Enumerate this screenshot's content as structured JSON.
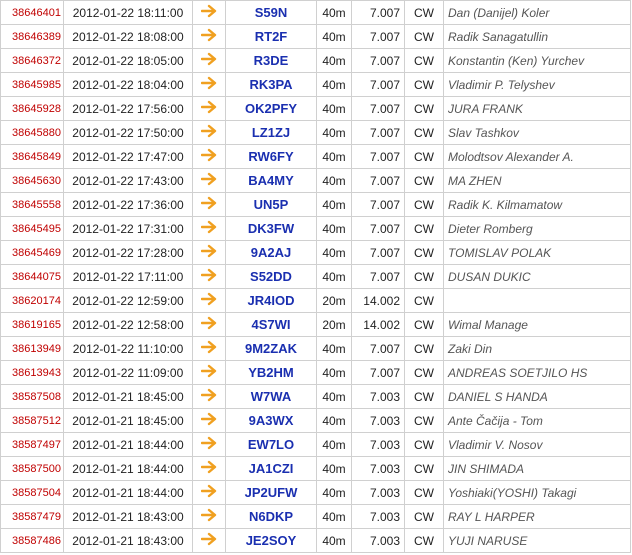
{
  "colors": {
    "id_link": "#c00000",
    "callsign": "#1a2fb0",
    "arrow": "#f0a020",
    "border": "#d0d0d0",
    "name": "#555555"
  },
  "arrow_icon": "arrow-right-icon",
  "rows": [
    {
      "id": "38646401",
      "ts": "2012-01-22 18:11:00",
      "call": "S59N",
      "band": "40m",
      "freq": "7.007",
      "mode": "CW",
      "name": "Dan (Danijel) Koler"
    },
    {
      "id": "38646389",
      "ts": "2012-01-22 18:08:00",
      "call": "RT2F",
      "band": "40m",
      "freq": "7.007",
      "mode": "CW",
      "name": "Radik Sanagatullin"
    },
    {
      "id": "38646372",
      "ts": "2012-01-22 18:05:00",
      "call": "R3DE",
      "band": "40m",
      "freq": "7.007",
      "mode": "CW",
      "name": "Konstantin (Ken) Yurchev"
    },
    {
      "id": "38645985",
      "ts": "2012-01-22 18:04:00",
      "call": "RK3PA",
      "band": "40m",
      "freq": "7.007",
      "mode": "CW",
      "name": "Vladimir P. Telyshev"
    },
    {
      "id": "38645928",
      "ts": "2012-01-22 17:56:00",
      "call": "OK2PFY",
      "band": "40m",
      "freq": "7.007",
      "mode": "CW",
      "name": "JURA FRANK"
    },
    {
      "id": "38645880",
      "ts": "2012-01-22 17:50:00",
      "call": "LZ1ZJ",
      "band": "40m",
      "freq": "7.007",
      "mode": "CW",
      "name": "Slav Tashkov"
    },
    {
      "id": "38645849",
      "ts": "2012-01-22 17:47:00",
      "call": "RW6FY",
      "band": "40m",
      "freq": "7.007",
      "mode": "CW",
      "name": "Molodtsov Alexander A."
    },
    {
      "id": "38645630",
      "ts": "2012-01-22 17:43:00",
      "call": "BA4MY",
      "band": "40m",
      "freq": "7.007",
      "mode": "CW",
      "name": "MA ZHEN"
    },
    {
      "id": "38645558",
      "ts": "2012-01-22 17:36:00",
      "call": "UN5P",
      "band": "40m",
      "freq": "7.007",
      "mode": "CW",
      "name": "Radik K. Kilmamatow"
    },
    {
      "id": "38645495",
      "ts": "2012-01-22 17:31:00",
      "call": "DK3FW",
      "band": "40m",
      "freq": "7.007",
      "mode": "CW",
      "name": "Dieter Romberg"
    },
    {
      "id": "38645469",
      "ts": "2012-01-22 17:28:00",
      "call": "9A2AJ",
      "band": "40m",
      "freq": "7.007",
      "mode": "CW",
      "name": "TOMISLAV POLAK"
    },
    {
      "id": "38644075",
      "ts": "2012-01-22 17:11:00",
      "call": "S52DD",
      "band": "40m",
      "freq": "7.007",
      "mode": "CW",
      "name": "DUSAN DUKIC"
    },
    {
      "id": "38620174",
      "ts": "2012-01-22 12:59:00",
      "call": "JR4IOD",
      "band": "20m",
      "freq": "14.002",
      "mode": "CW",
      "name": ""
    },
    {
      "id": "38619165",
      "ts": "2012-01-22 12:58:00",
      "call": "4S7WI",
      "band": "20m",
      "freq": "14.002",
      "mode": "CW",
      "name": "Wimal Manage"
    },
    {
      "id": "38613949",
      "ts": "2012-01-22 11:10:00",
      "call": "9M2ZAK",
      "band": "40m",
      "freq": "7.007",
      "mode": "CW",
      "name": "Zaki Din"
    },
    {
      "id": "38613943",
      "ts": "2012-01-22 11:09:00",
      "call": "YB2HM",
      "band": "40m",
      "freq": "7.007",
      "mode": "CW",
      "name": "ANDREAS SOETJILO HS"
    },
    {
      "id": "38587508",
      "ts": "2012-01-21 18:45:00",
      "call": "W7WA",
      "band": "40m",
      "freq": "7.003",
      "mode": "CW",
      "name": "DANIEL S HANDA"
    },
    {
      "id": "38587512",
      "ts": "2012-01-21 18:45:00",
      "call": "9A3WX",
      "band": "40m",
      "freq": "7.003",
      "mode": "CW",
      "name": "Ante Čačija - Tom"
    },
    {
      "id": "38587497",
      "ts": "2012-01-21 18:44:00",
      "call": "EW7LO",
      "band": "40m",
      "freq": "7.003",
      "mode": "CW",
      "name": "Vladimir V. Nosov"
    },
    {
      "id": "38587500",
      "ts": "2012-01-21 18:44:00",
      "call": "JA1CZI",
      "band": "40m",
      "freq": "7.003",
      "mode": "CW",
      "name": "JIN SHIMADA"
    },
    {
      "id": "38587504",
      "ts": "2012-01-21 18:44:00",
      "call": "JP2UFW",
      "band": "40m",
      "freq": "7.003",
      "mode": "CW",
      "name": "Yoshiaki(YOSHI) Takagi"
    },
    {
      "id": "38587479",
      "ts": "2012-01-21 18:43:00",
      "call": "N6DKP",
      "band": "40m",
      "freq": "7.003",
      "mode": "CW",
      "name": "RAY L HARPER"
    },
    {
      "id": "38587486",
      "ts": "2012-01-21 18:43:00",
      "call": "JE2SOY",
      "band": "40m",
      "freq": "7.003",
      "mode": "CW",
      "name": "YUJI NARUSE"
    }
  ]
}
